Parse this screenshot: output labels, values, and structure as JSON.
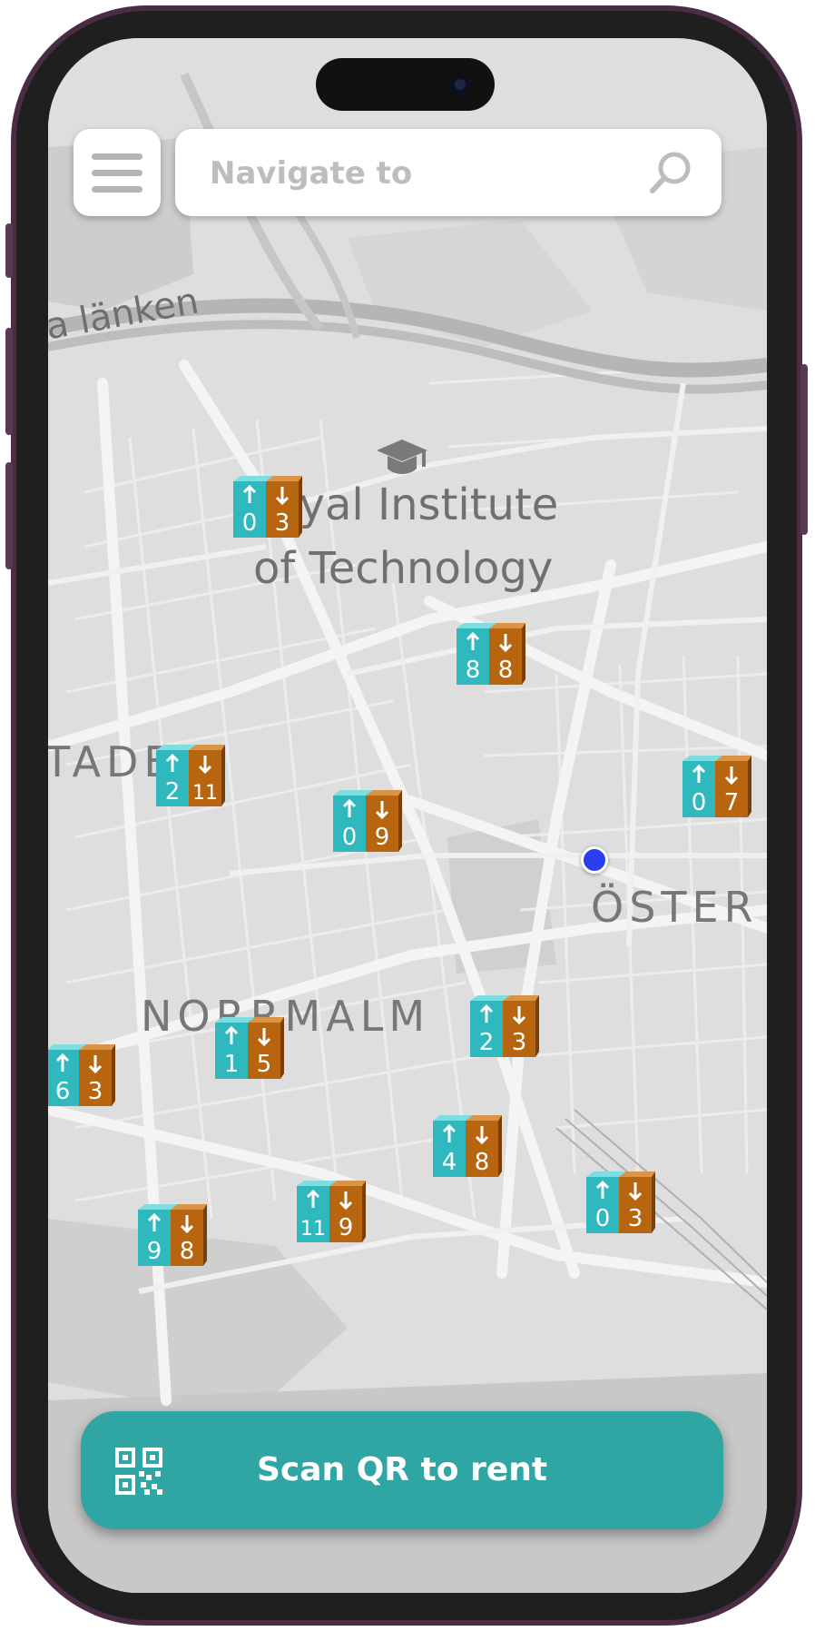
{
  "search": {
    "placeholder": "Navigate to"
  },
  "map": {
    "labels": {
      "road": "a länken",
      "institute_line1": "Royal Institute",
      "institute_line2": "of Technology",
      "district_1": "TADEN",
      "district_2": "NORRMALM",
      "district_3": "ÖSTER",
      "district_4": "N"
    },
    "stations": [
      {
        "up": "0",
        "down": "3"
      },
      {
        "up": "8",
        "down": "8"
      },
      {
        "up": "2",
        "down": "11"
      },
      {
        "up": "0",
        "down": "9"
      },
      {
        "up": "0",
        "down": "7"
      },
      {
        "up": "2",
        "down": "3"
      },
      {
        "up": "1",
        "down": "5"
      },
      {
        "up": "6",
        "down": "3"
      },
      {
        "up": "4",
        "down": "8"
      },
      {
        "up": "0",
        "down": "3"
      },
      {
        "up": "11",
        "down": "9"
      },
      {
        "up": "9",
        "down": "8"
      }
    ]
  },
  "scan_button": {
    "label": "Scan QR to rent",
    "icon": "qr-code-icon"
  },
  "colors": {
    "accent": "#2fa6a3",
    "station_up": "#2fb8bd",
    "station_down": "#b8650f",
    "frame": "#4a2d45",
    "user_location": "#2a3ef0"
  }
}
